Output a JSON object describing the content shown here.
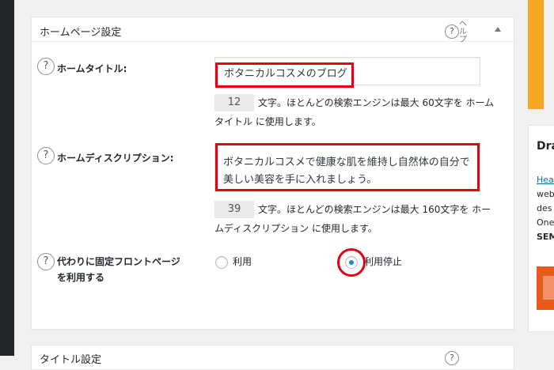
{
  "panel": {
    "title": "ホームページ設定",
    "help_label": "ヘルプ"
  },
  "fields": {
    "home_title": {
      "label": "ホームタイトル:",
      "value": "ボタニカルコスメのブログ",
      "count": "12",
      "note_line1": "文字。ほとんどの検索エンジンは最大 60文字を ホーム",
      "note_line2": "タイトル に使用します。"
    },
    "home_description": {
      "label": "ホームディスクリプション:",
      "value": "ボタニカルコスメで健康な肌を維持し自然体の自分で美しい美容を手に入れましょう。",
      "count": "39",
      "note_line1": "文字。ほとんどの検索エンジンは最大 160文字を ホー",
      "note_line2": "ムディスクリプション に使用します。"
    },
    "static_front": {
      "label_line1": "代わりに固定フロントページ",
      "label_line2": "を利用する",
      "options": [
        {
          "label": "利用",
          "checked": false
        },
        {
          "label": "利用停止",
          "checked": true
        }
      ]
    }
  },
  "help_glyph": "?",
  "next_panel": {
    "title": "タイトル設定"
  },
  "sidebar": {
    "title": "Dra",
    "lines": [
      "Hea",
      "web",
      "des",
      "One",
      "SEM"
    ]
  },
  "colors": {
    "highlight": "#e60012",
    "accent": "#1e8cbe",
    "sidebar_orange": "#f7a823"
  }
}
